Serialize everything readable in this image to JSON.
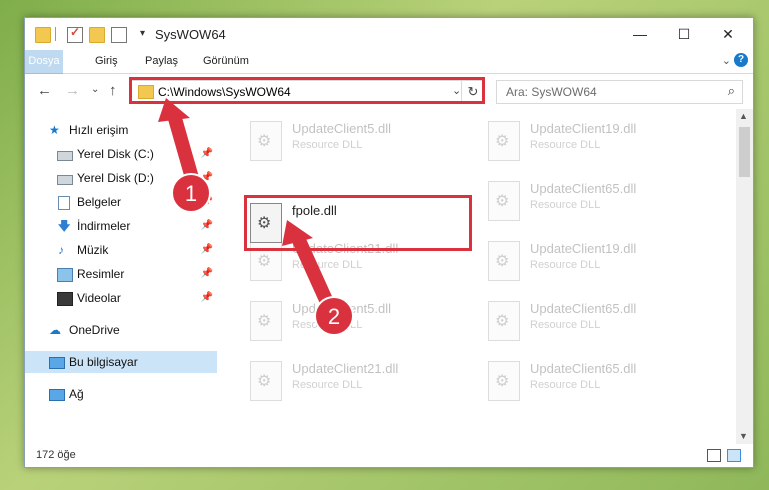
{
  "window": {
    "title": "SysWOW64",
    "controls": {
      "minimize": "—",
      "maximize": "☐",
      "close": "✕"
    }
  },
  "ribbon": {
    "tabs": [
      {
        "label": "Dosya"
      },
      {
        "label": "Giriş"
      },
      {
        "label": "Paylaş"
      },
      {
        "label": "Görünüm"
      }
    ],
    "help": "?"
  },
  "address": {
    "path": "C:\\Windows\\SysWOW64",
    "search_placeholder": "Ara: SysWOW64"
  },
  "nav": {
    "quick_access": "Hızlı erişim",
    "items": [
      {
        "label": "Yerel Disk (C:)"
      },
      {
        "label": "Yerel Disk (D:)"
      },
      {
        "label": "Belgeler"
      },
      {
        "label": "İndirmeler"
      },
      {
        "label": "Müzik"
      },
      {
        "label": "Resimler"
      },
      {
        "label": "Videolar"
      }
    ],
    "onedrive": "OneDrive",
    "this_pc": "Bu bilgisayar",
    "network": "Ağ"
  },
  "files": {
    "selected": {
      "name": "fpole.dll",
      "desc": ""
    },
    "background": [
      {
        "name": "UpdateClient5.dll",
        "desc": "Resource DLL"
      },
      {
        "name": "UpdateClient19.dll",
        "desc": "Resource DLL"
      },
      {
        "name": "UpdateClient65.dll",
        "desc": "Resource DLL"
      },
      {
        "name": "UpdateClient21.dll",
        "desc": "Resource DLL"
      },
      {
        "name": "UpdateClient19.dll",
        "desc": "Resource DLL"
      },
      {
        "name": "UpdateClient5.dll",
        "desc": "Resource DLL"
      },
      {
        "name": "UpdateClient65.dll",
        "desc": "Resource DLL"
      },
      {
        "name": "UpdateClient21.dll",
        "desc": "Resource DLL"
      },
      {
        "name": "UpdateClient65.dll",
        "desc": "Resource DLL"
      }
    ]
  },
  "status": {
    "count": "172 öğe"
  },
  "annotations": [
    {
      "label": "1"
    },
    {
      "label": "2"
    }
  ],
  "colors": {
    "accent": "#1979ca",
    "highlight": "#d9323e"
  }
}
